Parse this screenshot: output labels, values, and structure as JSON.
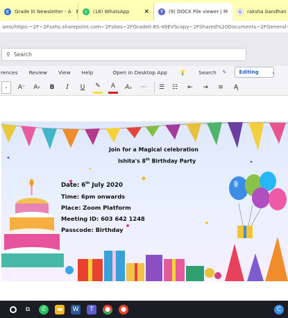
{
  "browser": {
    "tabs": [
      {
        "label": "Grade III Newsletter - A",
        "icon": "chrome-doc-icon",
        "color": "#2f6de1",
        "active": false
      },
      {
        "label": "(18) WhatsApp",
        "icon": "whatsapp-icon",
        "color": "#25c15c",
        "active": false
      },
      {
        "label": "(9) DOCX File viewer | M",
        "icon": "teams-icon",
        "color": "#5b5fc7",
        "active": true
      },
      {
        "label": "raksha bandhan",
        "icon": "google-icon",
        "color": "#4285f4",
        "active": false
      }
    ],
    "address": "ams/https:~2F~2Fsxhs.sharepoint.com~2Fsites~2FGradeII-8S-49EVScopy~2FShared%20Documents~2FGeneral~"
  },
  "teams": {
    "search_placeholder": "Search"
  },
  "menu": {
    "items": [
      "rences",
      "Review",
      "View",
      "Help",
      "Open in Desktop App"
    ],
    "search_label": "Search",
    "editing_label": "Editing"
  },
  "format_toolbar": {
    "grow_font": "A",
    "shrink_font": "A",
    "bold": "B",
    "italic": "I",
    "underline": "U",
    "font_color": "A",
    "more": "···"
  },
  "invitation": {
    "line1": "Join for a Magical celebration",
    "line2_name": "Ishita's 8",
    "line2_sup": "th",
    "line2_rest": " Birthday Party",
    "date_label": "Date: 6",
    "date_sup": "th",
    "date_rest": " July 2020",
    "time": "Time: 6pm onwards",
    "place": "Place: Zoom Platform",
    "meeting": "Meeting ID: 603 642 1248",
    "passcode": "Passcode: Birthday"
  },
  "colors": {
    "tabbar": "#ffffb5",
    "teams_purple": "#5b5fc7",
    "taskbar": "#1c1c24",
    "editing_blue": "#2b5cc5"
  }
}
